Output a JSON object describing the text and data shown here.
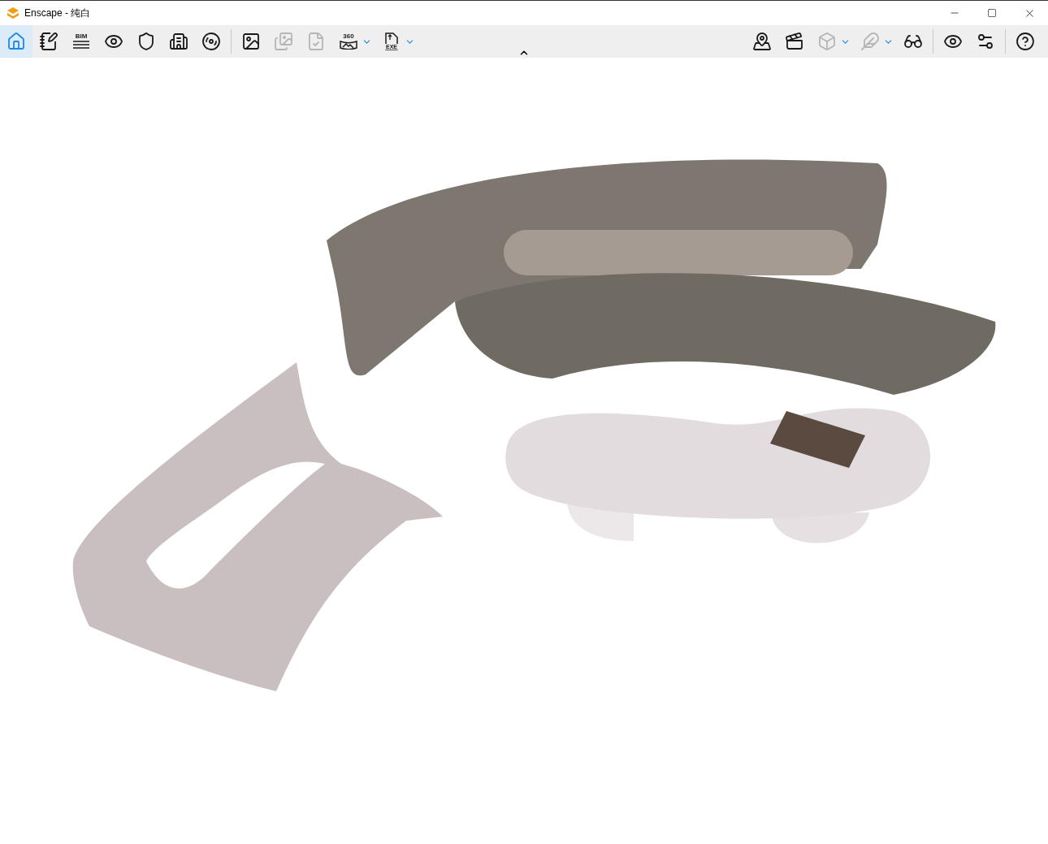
{
  "window": {
    "title": "Enscape - 纯白"
  },
  "toolbar": {
    "left_groups": [
      [
        {
          "kind": "home",
          "selected": true,
          "disabled": false,
          "dropdown": false
        },
        {
          "kind": "notes",
          "selected": false,
          "disabled": false,
          "dropdown": false
        },
        {
          "kind": "bim",
          "label": "BIM",
          "selected": false,
          "disabled": false,
          "dropdown": false
        },
        {
          "kind": "view",
          "selected": false,
          "disabled": false,
          "dropdown": false
        },
        {
          "kind": "assets",
          "selected": false,
          "disabled": false,
          "dropdown": false
        },
        {
          "kind": "buildings",
          "selected": false,
          "disabled": false,
          "dropdown": false
        },
        {
          "kind": "video",
          "selected": false,
          "disabled": false,
          "dropdown": false
        }
      ],
      [
        {
          "kind": "screenshot",
          "selected": false,
          "disabled": false,
          "dropdown": false
        },
        {
          "kind": "gallery",
          "selected": false,
          "disabled": true,
          "dropdown": false
        },
        {
          "kind": "upload",
          "selected": false,
          "disabled": true,
          "dropdown": false
        },
        {
          "kind": "panorama",
          "label": "360",
          "selected": false,
          "disabled": false,
          "dropdown": true
        },
        {
          "kind": "exe",
          "label": "EXE",
          "selected": false,
          "disabled": false,
          "dropdown": true
        }
      ]
    ],
    "right_groups": [
      [
        {
          "kind": "map",
          "selected": false,
          "disabled": false,
          "dropdown": false
        },
        {
          "kind": "batch",
          "selected": false,
          "disabled": false,
          "dropdown": false
        },
        {
          "kind": "cube",
          "selected": false,
          "disabled": true,
          "dropdown": true
        },
        {
          "kind": "wings",
          "selected": false,
          "disabled": true,
          "dropdown": true
        },
        {
          "kind": "vr",
          "selected": false,
          "disabled": false,
          "dropdown": false
        }
      ],
      [
        {
          "kind": "visual",
          "selected": false,
          "disabled": false,
          "dropdown": false
        },
        {
          "kind": "settings",
          "selected": false,
          "disabled": false,
          "dropdown": false
        }
      ],
      [
        {
          "kind": "help",
          "selected": false,
          "disabled": false,
          "dropdown": false
        }
      ]
    ],
    "collapsed": false
  }
}
